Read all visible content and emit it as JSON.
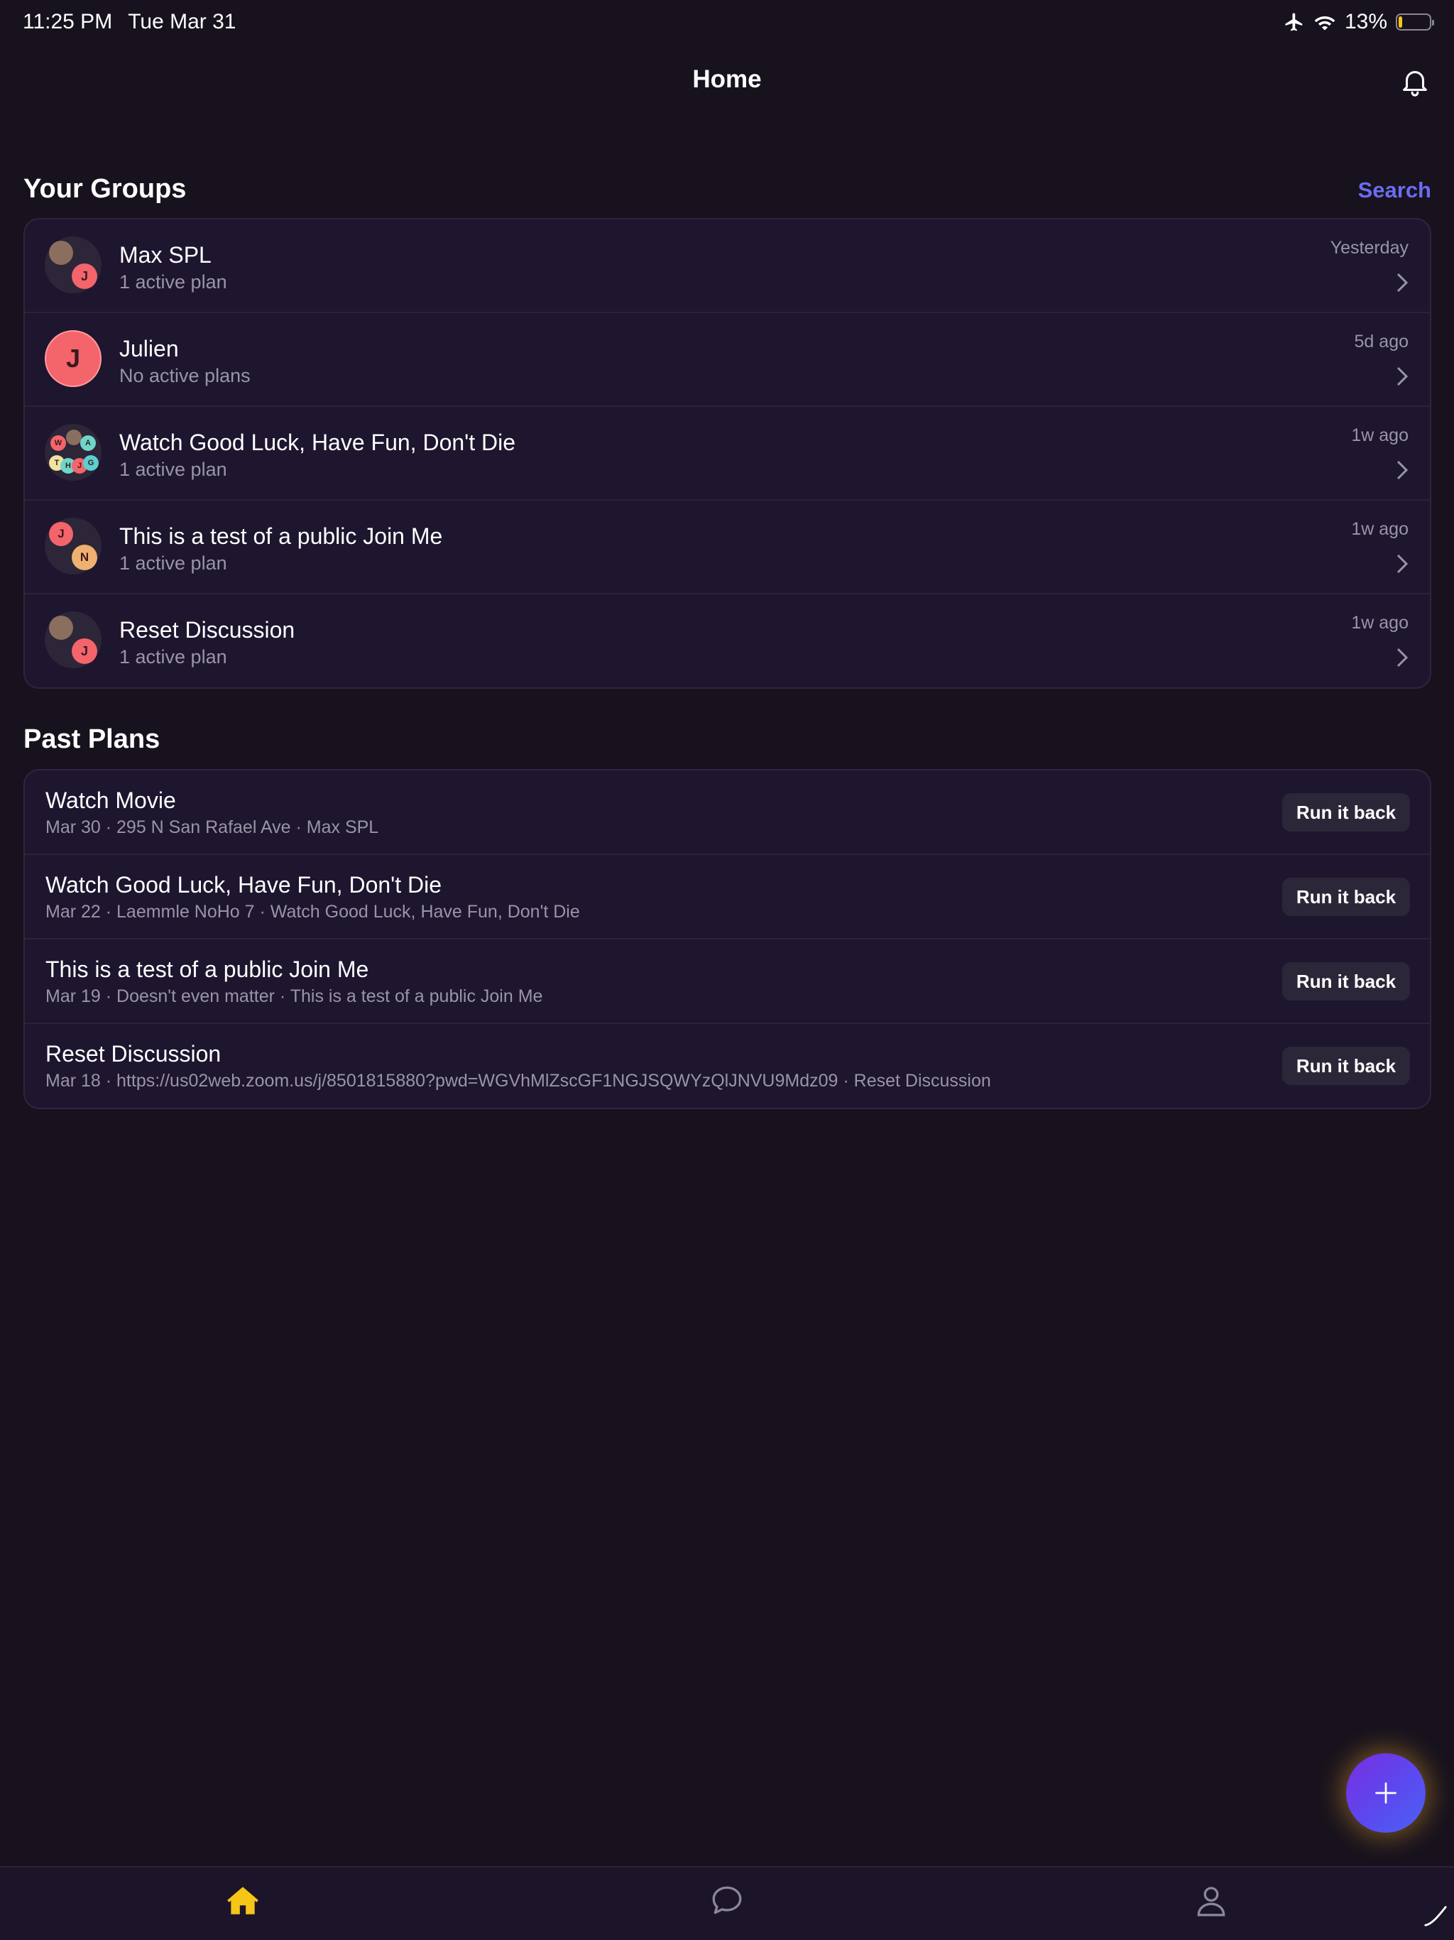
{
  "status_bar": {
    "time": "11:25 PM",
    "date": "Tue Mar 31",
    "battery": "13%",
    "battery_level": 0.13
  },
  "header": {
    "title": "Home"
  },
  "groups": {
    "title": "Your Groups",
    "search_label": "Search",
    "items": [
      {
        "name": "Max SPL",
        "subtitle": "1 active plan",
        "time": "Yesterday"
      },
      {
        "name": "Julien",
        "subtitle": "No active plans",
        "time": "5d ago",
        "initial": "J"
      },
      {
        "name": "Watch Good Luck, Have Fun, Don't Die",
        "subtitle": "1 active plan",
        "time": "1w ago"
      },
      {
        "name": "This is a test of a public Join Me",
        "subtitle": "1 active plan",
        "time": "1w ago"
      },
      {
        "name": "Reset Discussion",
        "subtitle": "1 active plan",
        "time": "1w ago"
      }
    ]
  },
  "past_plans": {
    "title": "Past Plans",
    "button_label": "Run it back",
    "items": [
      {
        "title": "Watch Movie",
        "subtitle": "Mar 30 · 295 N San Rafael Ave · Max SPL"
      },
      {
        "title": "Watch Good Luck, Have Fun, Don't Die",
        "subtitle": "Mar 22 · Laemmle NoHo 7 · Watch Good Luck, Have Fun, Don't Die"
      },
      {
        "title": "This is a test of a public Join Me",
        "subtitle": "Mar 19 · Doesn't even matter · This is a test of a public Join Me"
      },
      {
        "title": "Reset Discussion",
        "subtitle": "Mar 18 · https://us02web.zoom.us/j/8501815880?pwd=WGVhMlZscGF1NGJSQWYzQlJNVU9Mdz09 · Reset Discussion"
      }
    ]
  },
  "tab_bar": {
    "items": [
      "home-icon",
      "chat-icon",
      "profile-icon"
    ],
    "active": "home-icon"
  },
  "colors": {
    "accent": "#6a6cf0",
    "active_tab": "#f5c518",
    "avatar_red": "#f4646b",
    "avatar_orange": "#f0b070",
    "avatar_teal": "#6fd6c9"
  }
}
